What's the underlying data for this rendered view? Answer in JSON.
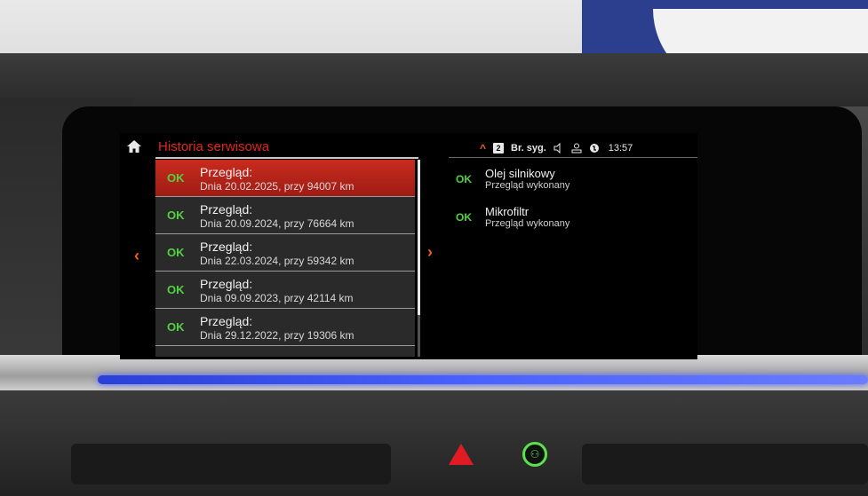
{
  "header": {
    "title": "Historia serwisowa",
    "home_icon": "home-icon"
  },
  "status_bar": {
    "chevron": "^",
    "badge": "2",
    "br_label": "Br. syg.",
    "speaker_icon": "speaker-icon",
    "person_icon": "profile-icon",
    "phone_icon": "phone-icon",
    "time": "13:57"
  },
  "nav": {
    "left": "‹",
    "right": "›"
  },
  "list": {
    "items": [
      {
        "status": "OK",
        "title": "Przegląd:",
        "detail": "Dnia 20.02.2025, przy 94007 km",
        "selected": true
      },
      {
        "status": "OK",
        "title": "Przegląd:",
        "detail": "Dnia 20.09.2024, przy 76664 km",
        "selected": false
      },
      {
        "status": "OK",
        "title": "Przegląd:",
        "detail": "Dnia 22.03.2024, przy 59342 km",
        "selected": false
      },
      {
        "status": "OK",
        "title": "Przegląd:",
        "detail": "Dnia 09.09.2023, przy 42114 km",
        "selected": false
      },
      {
        "status": "OK",
        "title": "Przegląd:",
        "detail": "Dnia 29.12.2022, przy 19306 km",
        "selected": false
      }
    ]
  },
  "details": {
    "items": [
      {
        "status": "OK",
        "name": "Olej silnikowy",
        "sub": "Przegląd wykonany"
      },
      {
        "status": "OK",
        "name": "Mikrofiltr",
        "sub": "Przegląd wykonany"
      }
    ]
  },
  "console": {
    "hazard_icon": "hazard-warning-icon",
    "indicator_icon": "traffic-light-icon",
    "accent": "#4a62ff",
    "ok_color": "#51d23f",
    "highlight_color": "#c92b1e"
  }
}
